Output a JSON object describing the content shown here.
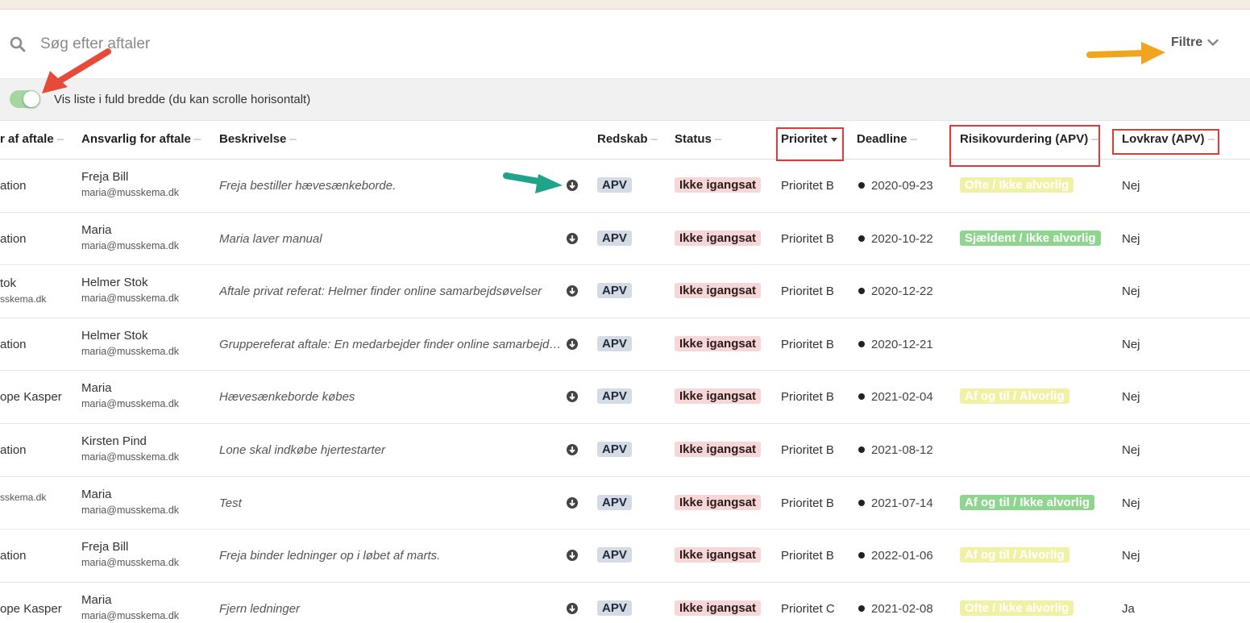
{
  "search": {
    "placeholder": "Søg efter aftaler",
    "icon": "search-icon"
  },
  "filter": {
    "label": "Filtre",
    "icon": "chevron-down-icon"
  },
  "toggle": {
    "label": "Vis liste i fuld bredde (du kan scrolle horisontalt)",
    "checked": true,
    "color": "#a5d6a0"
  },
  "columns": {
    "owner": "r af aftale",
    "responsible": "Ansvarlig for aftale",
    "description": "Beskrivelse",
    "tool": "Redskab",
    "status": "Status",
    "priority": "Prioritet",
    "deadline": "Deadline",
    "risk": "Risikovurdering (APV)",
    "law": "Lovkrav (APV)",
    "sort_dash": "–"
  },
  "colors": {
    "badge_apv": "#d5dbe4",
    "badge_status": "#f6d6d6",
    "risk_yellow": "#f1f1a6",
    "risk_green": "#8fd48f",
    "highlight_box": "#e03a3a",
    "arrow_red": "#e84a3a",
    "arrow_teal": "#1fa38a",
    "arrow_orange": "#f0a51c"
  },
  "rows": [
    {
      "owner": "ation",
      "owner_sub": "",
      "resp_name": "Freja Bill",
      "resp_email": "maria@musskema.dk",
      "desc": "Freja bestiller hævesænkeborde.",
      "tool": "APV",
      "status": "Ikke igangsat",
      "priority": "Prioritet B",
      "deadline": "2020-09-23",
      "risk": "Ofte / Ikke alvorlig",
      "risk_color": "yellow",
      "law": "Nej"
    },
    {
      "owner": "ation",
      "owner_sub": "",
      "resp_name": "Maria",
      "resp_email": "maria@musskema.dk",
      "desc": "Maria laver manual",
      "tool": "APV",
      "status": "Ikke igangsat",
      "priority": "Prioritet B",
      "deadline": "2020-10-22",
      "risk": "Sjældent / Ikke alvorlig",
      "risk_color": "green",
      "law": "Nej"
    },
    {
      "owner": "tok",
      "owner_sub": "sskema.dk",
      "resp_name": "Helmer Stok",
      "resp_email": "maria@musskema.dk",
      "desc": "Aftale privat referat: Helmer finder online samarbejdsøvelser",
      "tool": "APV",
      "status": "Ikke igangsat",
      "priority": "Prioritet B",
      "deadline": "2020-12-22",
      "risk": "",
      "risk_color": "",
      "law": "Nej"
    },
    {
      "owner": "ation",
      "owner_sub": "",
      "resp_name": "Helmer Stok",
      "resp_email": "maria@musskema.dk",
      "desc": "Gruppereferat aftale: En medarbejder finder online samarbejdsøvelser",
      "tool": "APV",
      "status": "Ikke igangsat",
      "priority": "Prioritet B",
      "deadline": "2020-12-21",
      "risk": "",
      "risk_color": "",
      "law": "Nej"
    },
    {
      "owner": "ope Kasper",
      "owner_sub": "",
      "resp_name": "Maria",
      "resp_email": "maria@musskema.dk",
      "desc": "Hævesænkeborde købes",
      "tool": "APV",
      "status": "Ikke igangsat",
      "priority": "Prioritet B",
      "deadline": "2021-02-04",
      "risk": "Af og til / Alvorlig",
      "risk_color": "yellow",
      "law": "Nej"
    },
    {
      "owner": "ation",
      "owner_sub": "",
      "resp_name": "Kirsten Pind",
      "resp_email": "maria@musskema.dk",
      "desc": "Lone skal indkøbe hjertestarter",
      "tool": "APV",
      "status": "Ikke igangsat",
      "priority": "Prioritet B",
      "deadline": "2021-08-12",
      "risk": "",
      "risk_color": "",
      "law": "Nej"
    },
    {
      "owner": "",
      "owner_sub": "sskema.dk",
      "resp_name": "Maria",
      "resp_email": "maria@musskema.dk",
      "desc": "Test",
      "tool": "APV",
      "status": "Ikke igangsat",
      "priority": "Prioritet B",
      "deadline": "2021-07-14",
      "risk": "Af og til / Ikke alvorlig",
      "risk_color": "green",
      "law": "Nej"
    },
    {
      "owner": "ation",
      "owner_sub": "",
      "resp_name": "Freja Bill",
      "resp_email": "maria@musskema.dk",
      "desc": "Freja binder ledninger op i løbet af marts.",
      "tool": "APV",
      "status": "Ikke igangsat",
      "priority": "Prioritet B",
      "deadline": "2022-01-06",
      "risk": "Af og til / Alvorlig",
      "risk_color": "yellow",
      "law": "Nej"
    },
    {
      "owner": "ope Kasper",
      "owner_sub": "",
      "resp_name": "Maria",
      "resp_email": "maria@musskema.dk",
      "desc": "Fjern ledninger",
      "tool": "APV",
      "status": "Ikke igangsat",
      "priority": "Prioritet C",
      "deadline": "2021-02-08",
      "risk": "Ofte / Ikke alvorlig",
      "risk_color": "yellow",
      "law": "Ja"
    }
  ]
}
